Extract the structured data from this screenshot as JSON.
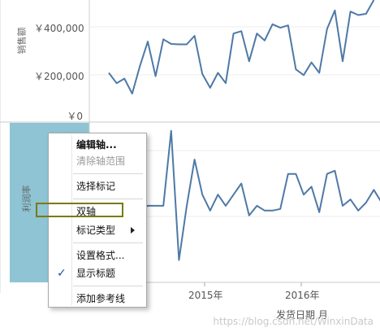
{
  "charts": {
    "top": {
      "yaxis_title": "销售额",
      "ticks": [
        "￥400,000",
        "￥200,000",
        "￥0"
      ]
    },
    "bottom": {
      "yaxis_title": "利润率"
    },
    "xaxis": {
      "title": "发货日期 月",
      "ticks": [
        "2015年",
        "2016年"
      ]
    }
  },
  "colors": {
    "line": "#4e79a7",
    "selected_pane": "#8ec4d4",
    "highlight": "#7a7a12"
  },
  "context_menu": {
    "items": [
      {
        "label": "编辑轴...",
        "style": "bold"
      },
      {
        "label": "清除轴范围",
        "style": "disabled"
      },
      {
        "label": "选择标记",
        "style": "normal"
      },
      {
        "label": "双轴",
        "style": "highlighted"
      },
      {
        "label": "标记类型",
        "style": "submenu"
      },
      {
        "label": "设置格式...",
        "style": "normal"
      },
      {
        "label": "显示标题",
        "style": "checked"
      },
      {
        "label": "添加参考线",
        "style": "normal"
      }
    ]
  },
  "watermark": "https://blog.csdn.net/WinxinData",
  "chart_data": [
    {
      "type": "line",
      "title": "",
      "ylabel": "销售额",
      "xlabel": "发货日期 月",
      "ylim": [
        0,
        500000
      ],
      "x_ticks": [
        "2015年",
        "2016年"
      ],
      "x": [
        "2013-08",
        "2013-09",
        "2013-10",
        "2013-11",
        "2013-12",
        "2014-01",
        "2014-02",
        "2014-03",
        "2014-04",
        "2014-05",
        "2014-06",
        "2014-07",
        "2014-08",
        "2014-09",
        "2014-10",
        "2014-11",
        "2014-12",
        "2015-01",
        "2015-02",
        "2015-03",
        "2015-04",
        "2015-05",
        "2015-06",
        "2015-07",
        "2015-08",
        "2015-09",
        "2015-10",
        "2015-11",
        "2015-12",
        "2016-01",
        "2016-02",
        "2016-03",
        "2016-04",
        "2016-05",
        "2016-06",
        "2016-07",
        "2016-08",
        "2016-09",
        "2016-10",
        "2016-11",
        "2016-12"
      ],
      "series": [
        {
          "values": [
            185000,
            140000,
            160000,
            95000,
            215000,
            320000,
            170000,
            330000,
            310000,
            308000,
            308000,
            345000,
            180000,
            120000,
            185000,
            140000,
            355000,
            365000,
            235000,
            355000,
            325000,
            395000,
            380000,
            390000,
            200000,
            175000,
            230000,
            185000,
            375000,
            455000,
            235000,
            450000,
            435000,
            440000,
            500000,
            null,
            null,
            null,
            null,
            null,
            null
          ]
        }
      ]
    },
    {
      "type": "line",
      "title": "",
      "ylabel": "利润率",
      "xlabel": "发货日期 月",
      "ylim": [
        0,
        1
      ],
      "x_ticks": [
        "2015年",
        "2016年"
      ],
      "x": [
        "2013-08",
        "2013-09",
        "2013-10",
        "2013-11",
        "2013-12",
        "2014-01",
        "2014-02",
        "2014-03",
        "2014-04",
        "2014-05",
        "2014-06",
        "2014-07",
        "2014-08",
        "2014-09",
        "2014-10",
        "2014-11",
        "2014-12",
        "2015-01",
        "2015-02",
        "2015-03",
        "2015-04",
        "2015-05",
        "2015-06",
        "2015-07",
        "2015-08",
        "2015-09",
        "2015-10",
        "2015-11",
        "2015-12",
        "2016-01",
        "2016-02",
        "2016-03",
        "2016-04",
        "2016-05",
        "2016-06",
        "2016-07",
        "2016-08",
        "2016-09",
        "2016-10",
        "2016-11",
        "2016-12"
      ],
      "series": [
        {
          "values": [
            0.42,
            0.5,
            0.7,
            0.42,
            0.46,
            0.48,
            0.48,
            0.48,
            0.95,
            0.14,
            0.48,
            0.77,
            0.55,
            0.45,
            0.55,
            0.48,
            0.55,
            0.62,
            0.42,
            0.48,
            0.45,
            0.45,
            0.46,
            0.68,
            0.68,
            0.55,
            0.6,
            0.44,
            0.68,
            0.7,
            0.48,
            0.52,
            0.45,
            0.5,
            0.58,
            0.5,
            null,
            null,
            null,
            null,
            null
          ]
        }
      ]
    }
  ]
}
